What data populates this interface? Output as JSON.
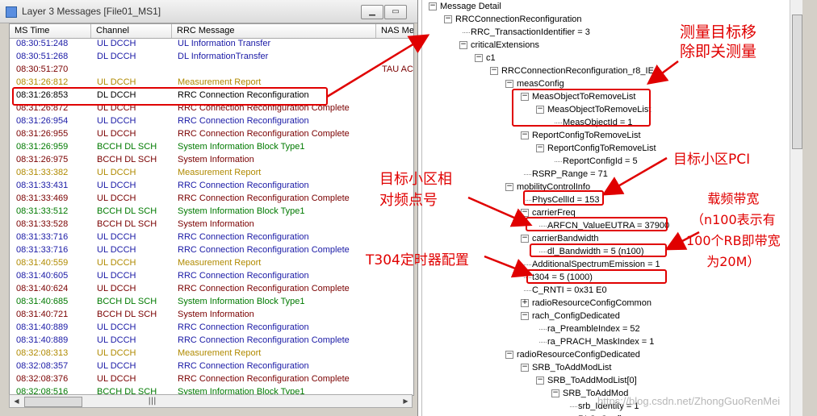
{
  "window": {
    "title": "Layer 3 Messages [File01_MS1]"
  },
  "table": {
    "columns": [
      "MS Time",
      "Channel",
      "RRC Message",
      "NAS Me"
    ],
    "rows": [
      {
        "time": "08:30:51:248",
        "channel": "UL DCCH",
        "message": "UL Information Transfer",
        "nas": "",
        "color": "#1a1aa6"
      },
      {
        "time": "08:30:51:268",
        "channel": "DL DCCH",
        "message": "DL InformationTransfer",
        "nas": "",
        "color": "#1a1aa6"
      },
      {
        "time": "08:30:51:270",
        "channel": "",
        "message": "",
        "nas": "TAU AC",
        "color": "#7a0000"
      },
      {
        "time": "08:31:26:812",
        "channel": "UL DCCH",
        "message": "Measurement Report",
        "nas": "",
        "color": "#b08a00"
      },
      {
        "time": "08:31:26:853",
        "channel": "DL DCCH",
        "message": "RRC Connection Reconfiguration",
        "nas": "",
        "color": "#000000"
      },
      {
        "time": "08:31:26:872",
        "channel": "UL DCCH",
        "message": "RRC Connection Reconfiguration Complete",
        "nas": "",
        "color": "#7a0000"
      },
      {
        "time": "08:31:26:954",
        "channel": "UL DCCH",
        "message": "RRC Connection Reconfiguration",
        "nas": "",
        "color": "#1a1aa6"
      },
      {
        "time": "08:31:26:955",
        "channel": "UL DCCH",
        "message": "RRC Connection Reconfiguration Complete",
        "nas": "",
        "color": "#7a0000"
      },
      {
        "time": "08:31:26:959",
        "channel": "BCCH DL SCH",
        "message": "System Information Block Type1",
        "nas": "",
        "color": "#007a00"
      },
      {
        "time": "08:31:26:975",
        "channel": "BCCH DL SCH",
        "message": "System Information",
        "nas": "",
        "color": "#7a0000"
      },
      {
        "time": "08:31:33:382",
        "channel": "UL DCCH",
        "message": "Measurement Report",
        "nas": "",
        "color": "#b08a00"
      },
      {
        "time": "08:31:33:431",
        "channel": "UL DCCH",
        "message": "RRC Connection Reconfiguration",
        "nas": "",
        "color": "#1a1aa6"
      },
      {
        "time": "08:31:33:469",
        "channel": "UL DCCH",
        "message": "RRC Connection Reconfiguration Complete",
        "nas": "",
        "color": "#7a0000"
      },
      {
        "time": "08:31:33:512",
        "channel": "BCCH DL SCH",
        "message": "System Information Block Type1",
        "nas": "",
        "color": "#007a00"
      },
      {
        "time": "08:31:33:528",
        "channel": "BCCH DL SCH",
        "message": "System Information",
        "nas": "",
        "color": "#7a0000"
      },
      {
        "time": "08:31:33:716",
        "channel": "UL DCCH",
        "message": "RRC Connection Reconfiguration",
        "nas": "",
        "color": "#1a1aa6"
      },
      {
        "time": "08:31:33:716",
        "channel": "UL DCCH",
        "message": "RRC Connection Reconfiguration Complete",
        "nas": "",
        "color": "#1a1aa6"
      },
      {
        "time": "08:31:40:559",
        "channel": "UL DCCH",
        "message": "Measurement Report",
        "nas": "",
        "color": "#b08a00"
      },
      {
        "time": "08:31:40:605",
        "channel": "UL DCCH",
        "message": "RRC Connection Reconfiguration",
        "nas": "",
        "color": "#1a1aa6"
      },
      {
        "time": "08:31:40:624",
        "channel": "UL DCCH",
        "message": "RRC Connection Reconfiguration Complete",
        "nas": "",
        "color": "#7a0000"
      },
      {
        "time": "08:31:40:685",
        "channel": "BCCH DL SCH",
        "message": "System Information Block Type1",
        "nas": "",
        "color": "#007a00"
      },
      {
        "time": "08:31:40:721",
        "channel": "BCCH DL SCH",
        "message": "System Information",
        "nas": "",
        "color": "#7a0000"
      },
      {
        "time": "08:31:40:889",
        "channel": "UL DCCH",
        "message": "RRC Connection Reconfiguration",
        "nas": "",
        "color": "#1a1aa6"
      },
      {
        "time": "08:31:40:889",
        "channel": "UL DCCH",
        "message": "RRC Connection Reconfiguration Complete",
        "nas": "",
        "color": "#1a1aa6"
      },
      {
        "time": "08:32:08:313",
        "channel": "UL DCCH",
        "message": "Measurement Report",
        "nas": "",
        "color": "#b08a00"
      },
      {
        "time": "08:32:08:357",
        "channel": "UL DCCH",
        "message": "RRC Connection Reconfiguration",
        "nas": "",
        "color": "#1a1aa6"
      },
      {
        "time": "08:32:08:376",
        "channel": "UL DCCH",
        "message": "RRC Connection Reconfiguration Complete",
        "nas": "",
        "color": "#7a0000"
      },
      {
        "time": "08:32:08:516",
        "channel": "BCCH DL SCH",
        "message": "System Information Block Type1",
        "nas": "",
        "color": "#007a00"
      }
    ]
  },
  "tree": [
    {
      "label": "Message Detail",
      "depth": 0,
      "expander": "minus"
    },
    {
      "label": "RRCConnectionReconfiguration",
      "depth": 1,
      "expander": "minus"
    },
    {
      "label": "RRC_TransactionIdentifier = 3",
      "depth": 2,
      "expander": ""
    },
    {
      "label": "criticalExtensions",
      "depth": 2,
      "expander": "minus"
    },
    {
      "label": "c1",
      "depth": 3,
      "expander": "minus"
    },
    {
      "label": "RRCConnectionReconfiguration_r8_IEs",
      "depth": 4,
      "expander": "minus"
    },
    {
      "label": "measConfig",
      "depth": 5,
      "expander": "minus"
    },
    {
      "label": "MeasObjectToRemoveList",
      "depth": 6,
      "expander": "minus"
    },
    {
      "label": "MeasObjectToRemoveList",
      "depth": 7,
      "expander": "minus"
    },
    {
      "label": "MeasObjectId = 1",
      "depth": 8,
      "expander": ""
    },
    {
      "label": "ReportConfigToRemoveList",
      "depth": 6,
      "expander": "minus"
    },
    {
      "label": "ReportConfigToRemoveList",
      "depth": 7,
      "expander": "minus"
    },
    {
      "label": "ReportConfigId = 5",
      "depth": 8,
      "expander": ""
    },
    {
      "label": "RSRP_Range = 71",
      "depth": 6,
      "expander": ""
    },
    {
      "label": "mobilityControlInfo",
      "depth": 5,
      "expander": "minus"
    },
    {
      "label": "PhysCellId = 153",
      "depth": 6,
      "expander": ""
    },
    {
      "label": "carrierFreq",
      "depth": 6,
      "expander": "minus"
    },
    {
      "label": "ARFCN_ValueEUTRA = 37900",
      "depth": 7,
      "expander": ""
    },
    {
      "label": "carrierBandwidth",
      "depth": 6,
      "expander": "minus"
    },
    {
      "label": "dl_Bandwidth = 5 (n100)",
      "depth": 7,
      "expander": ""
    },
    {
      "label": "AdditionalSpectrumEmission = 1",
      "depth": 6,
      "expander": ""
    },
    {
      "label": "t304 = 5 (1000)",
      "depth": 6,
      "expander": ""
    },
    {
      "label": "C_RNTI = 0x31 E0",
      "depth": 6,
      "expander": ""
    },
    {
      "label": "radioResourceConfigCommon",
      "depth": 6,
      "expander": "plus"
    },
    {
      "label": "rach_ConfigDedicated",
      "depth": 6,
      "expander": "minus"
    },
    {
      "label": "ra_PreambleIndex = 52",
      "depth": 7,
      "expander": ""
    },
    {
      "label": "ra_PRACH_MaskIndex = 1",
      "depth": 7,
      "expander": ""
    },
    {
      "label": "radioResourceConfigDedicated",
      "depth": 5,
      "expander": "minus"
    },
    {
      "label": "SRB_ToAddModList",
      "depth": 6,
      "expander": "minus"
    },
    {
      "label": "SRB_ToAddModList[0]",
      "depth": 7,
      "expander": "minus"
    },
    {
      "label": "SRB_ToAddMod",
      "depth": 8,
      "expander": "minus"
    },
    {
      "label": "srb_Identity = 1",
      "depth": 9,
      "expander": ""
    },
    {
      "label": "RLC_Config",
      "depth": 9,
      "expander": ""
    }
  ],
  "annotations": {
    "meas_remove": [
      "测量目标移",
      "除即关测量"
    ],
    "target_pci": "目标小区PCI",
    "target_freq": [
      "目标小区相",
      "对频点号"
    ],
    "bandwidth": [
      "载频带宽",
      "（n100表示有",
      "100个RB即带宽",
      "为20M）"
    ],
    "t304": "T304定时器配置"
  },
  "watermark": "https://blog.csdn.net/ZhongGuoRenMei",
  "colors": {
    "annotation": "#e00000",
    "selected_row_border": "#e00000"
  }
}
